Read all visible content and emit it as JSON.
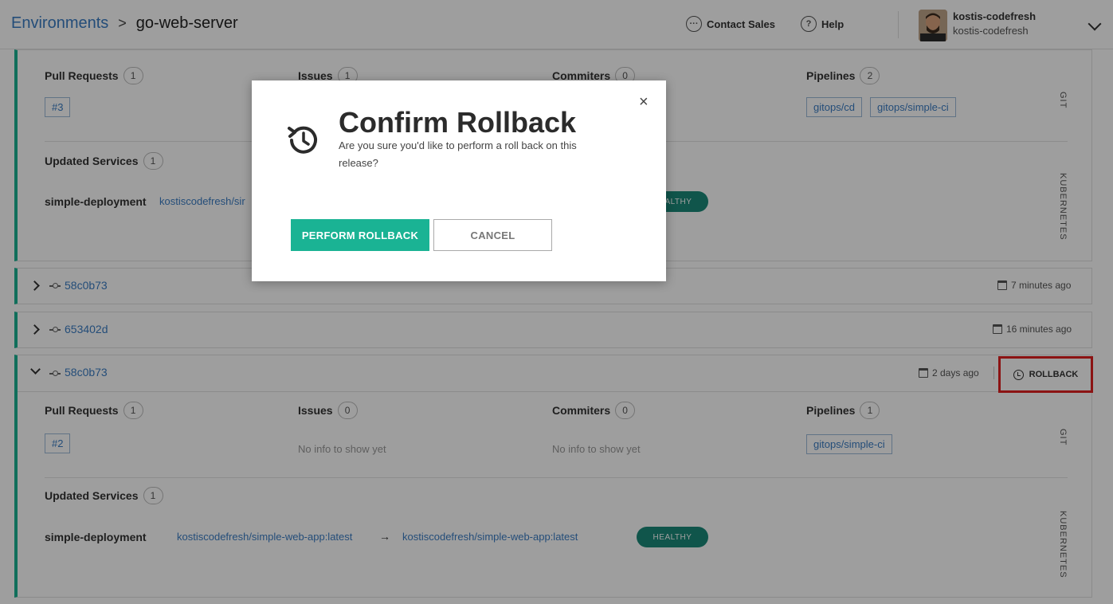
{
  "breadcrumb": {
    "environments": "Environments",
    "separator": ">",
    "current": "go-web-server"
  },
  "header": {
    "contact_sales": "Contact Sales",
    "help": "Help",
    "user_name": "kostis-codefresh",
    "user_org": "kostis-codefresh",
    "contact_icon": "chat-bubble-icon",
    "help_icon": "question-icon"
  },
  "top_card": {
    "pull_requests": {
      "label": "Pull Requests",
      "count": "1",
      "items": [
        "#3"
      ]
    },
    "issues": {
      "label": "Issues",
      "count": "1"
    },
    "commiters": {
      "label": "Commiters",
      "count": "0"
    },
    "pipelines": {
      "label": "Pipelines",
      "count": "2",
      "items": [
        "gitops/cd",
        "gitops/simple-ci"
      ]
    },
    "git_label": "GIT",
    "updated_services": {
      "label": "Updated Services",
      "count": "1"
    },
    "service": {
      "name": "simple-deployment",
      "from": "kostiscodefresh/sir",
      "status": "HEALTHY"
    },
    "kubernetes_label": "KUBERNETES"
  },
  "rows": [
    {
      "commit": "58c0b73",
      "date": "7 minutes ago"
    },
    {
      "commit": "653402d",
      "date": "16 minutes ago"
    }
  ],
  "expanded": {
    "commit": "58c0b73",
    "date": "2 days ago",
    "rollback_label": "ROLLBACK",
    "pull_requests": {
      "label": "Pull Requests",
      "count": "1",
      "items": [
        "#2"
      ]
    },
    "issues": {
      "label": "Issues",
      "count": "0",
      "empty": "No info to show yet"
    },
    "commiters": {
      "label": "Commiters",
      "count": "0",
      "empty": "No info to show yet"
    },
    "pipelines": {
      "label": "Pipelines",
      "count": "1",
      "items": [
        "gitops/simple-ci"
      ]
    },
    "git_label": "GIT",
    "updated_services": {
      "label": "Updated Services",
      "count": "1"
    },
    "service": {
      "name": "simple-deployment",
      "from": "kostiscodefresh/simple-web-app:latest",
      "arrow": "→",
      "to": "kostiscodefresh/simple-web-app:latest",
      "status": "HEALTHY"
    },
    "kubernetes_label": "KUBERNETES"
  },
  "modal": {
    "title": "Confirm Rollback",
    "message": "Are you sure you'd like to perform a roll back on this release?",
    "primary": "PERFORM ROLLBACK",
    "cancel": "CANCEL",
    "close": "×",
    "icon": "history-icon"
  },
  "colors": {
    "accent": "#1ab394",
    "link": "#3b7dc4",
    "healthy": "#1a8a7a",
    "highlight": "#e02020"
  }
}
